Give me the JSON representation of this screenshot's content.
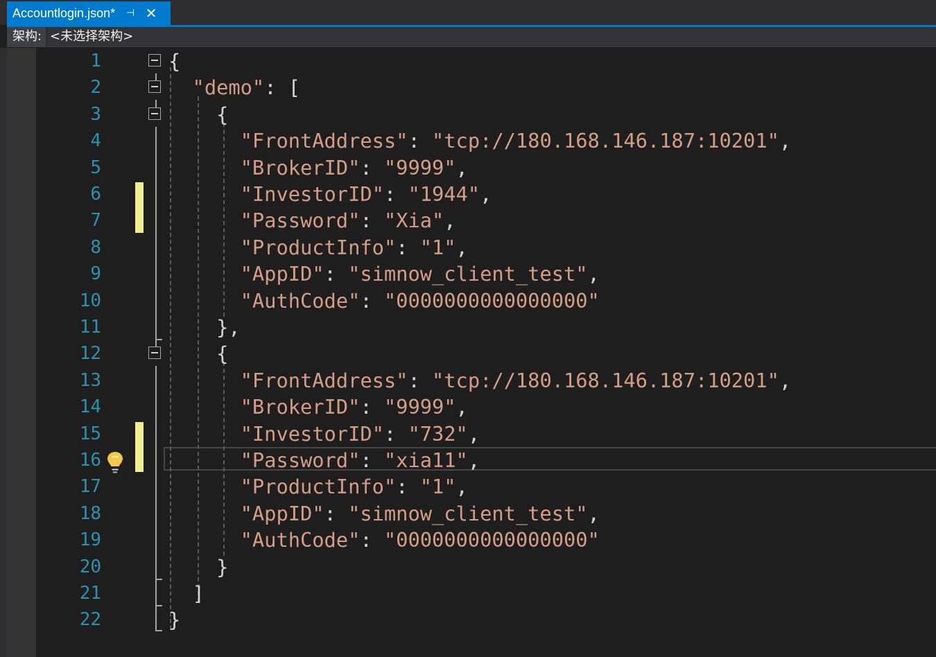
{
  "tab": {
    "title": "Accountlogin.json*",
    "pin_glyph": "⊣",
    "close_glyph": "✕"
  },
  "navbar": {
    "label": "架构:",
    "dropdown_value": "<未选择架构>"
  },
  "editor": {
    "line_numbers": [
      "1",
      "2",
      "3",
      "4",
      "5",
      "6",
      "7",
      "8",
      "9",
      "10",
      "11",
      "12",
      "13",
      "14",
      "15",
      "16",
      "17",
      "18",
      "19",
      "20",
      "21",
      "22"
    ],
    "lines": [
      [
        {
          "c": "p",
          "t": "{"
        }
      ],
      [
        {
          "c": "p",
          "t": "  "
        },
        {
          "c": "k",
          "t": "\"demo\""
        },
        {
          "c": "p",
          "t": ": ["
        }
      ],
      [
        {
          "c": "p",
          "t": "    {"
        }
      ],
      [
        {
          "c": "p",
          "t": "      "
        },
        {
          "c": "k",
          "t": "\"FrontAddress\""
        },
        {
          "c": "p",
          "t": ": "
        },
        {
          "c": "k",
          "t": "\"tcp://180.168.146.187:10201\""
        },
        {
          "c": "p",
          "t": ","
        }
      ],
      [
        {
          "c": "p",
          "t": "      "
        },
        {
          "c": "k",
          "t": "\"BrokerID\""
        },
        {
          "c": "p",
          "t": ": "
        },
        {
          "c": "k",
          "t": "\"9999\""
        },
        {
          "c": "p",
          "t": ","
        }
      ],
      [
        {
          "c": "p",
          "t": "      "
        },
        {
          "c": "k",
          "t": "\"InvestorID\""
        },
        {
          "c": "p",
          "t": ": "
        },
        {
          "c": "k",
          "t": "\"1944\""
        },
        {
          "c": "p",
          "t": ","
        }
      ],
      [
        {
          "c": "p",
          "t": "      "
        },
        {
          "c": "k",
          "t": "\"Password\""
        },
        {
          "c": "p",
          "t": ": "
        },
        {
          "c": "k",
          "t": "\"Xia\""
        },
        {
          "c": "p",
          "t": ","
        }
      ],
      [
        {
          "c": "p",
          "t": "      "
        },
        {
          "c": "k",
          "t": "\"ProductInfo\""
        },
        {
          "c": "p",
          "t": ": "
        },
        {
          "c": "k",
          "t": "\"1\""
        },
        {
          "c": "p",
          "t": ","
        }
      ],
      [
        {
          "c": "p",
          "t": "      "
        },
        {
          "c": "k",
          "t": "\"AppID\""
        },
        {
          "c": "p",
          "t": ": "
        },
        {
          "c": "k",
          "t": "\"simnow_client_test\""
        },
        {
          "c": "p",
          "t": ","
        }
      ],
      [
        {
          "c": "p",
          "t": "      "
        },
        {
          "c": "k",
          "t": "\"AuthCode\""
        },
        {
          "c": "p",
          "t": ": "
        },
        {
          "c": "k",
          "t": "\"0000000000000000\""
        }
      ],
      [
        {
          "c": "p",
          "t": "    },"
        }
      ],
      [
        {
          "c": "p",
          "t": "    {"
        }
      ],
      [
        {
          "c": "p",
          "t": "      "
        },
        {
          "c": "k",
          "t": "\"FrontAddress\""
        },
        {
          "c": "p",
          "t": ": "
        },
        {
          "c": "k",
          "t": "\"tcp://180.168.146.187:10201\""
        },
        {
          "c": "p",
          "t": ","
        }
      ],
      [
        {
          "c": "p",
          "t": "      "
        },
        {
          "c": "k",
          "t": "\"BrokerID\""
        },
        {
          "c": "p",
          "t": ": "
        },
        {
          "c": "k",
          "t": "\"9999\""
        },
        {
          "c": "p",
          "t": ","
        }
      ],
      [
        {
          "c": "p",
          "t": "      "
        },
        {
          "c": "k",
          "t": "\"InvestorID\""
        },
        {
          "c": "p",
          "t": ": "
        },
        {
          "c": "k",
          "t": "\"732\""
        },
        {
          "c": "p",
          "t": ","
        }
      ],
      [
        {
          "c": "p",
          "t": "      "
        },
        {
          "c": "k",
          "t": "\"Password\""
        },
        {
          "c": "p",
          "t": ": "
        },
        {
          "c": "k",
          "t": "\"xia11\""
        },
        {
          "c": "p",
          "t": ","
        }
      ],
      [
        {
          "c": "p",
          "t": "      "
        },
        {
          "c": "k",
          "t": "\"ProductInfo\""
        },
        {
          "c": "p",
          "t": ": "
        },
        {
          "c": "k",
          "t": "\"1\""
        },
        {
          "c": "p",
          "t": ","
        }
      ],
      [
        {
          "c": "p",
          "t": "      "
        },
        {
          "c": "k",
          "t": "\"AppID\""
        },
        {
          "c": "p",
          "t": ": "
        },
        {
          "c": "k",
          "t": "\"simnow_client_test\""
        },
        {
          "c": "p",
          "t": ","
        }
      ],
      [
        {
          "c": "p",
          "t": "      "
        },
        {
          "c": "k",
          "t": "\"AuthCode\""
        },
        {
          "c": "p",
          "t": ": "
        },
        {
          "c": "k",
          "t": "\"0000000000000000\""
        }
      ],
      [
        {
          "c": "p",
          "t": "    }"
        }
      ],
      [
        {
          "c": "p",
          "t": "  ]"
        }
      ],
      [
        {
          "c": "p",
          "t": "}"
        }
      ]
    ],
    "changed_lines": [
      6,
      7,
      15,
      16
    ],
    "current_line": 16,
    "lightbulb_line": 16,
    "fold_lines": [
      1,
      2,
      3,
      12
    ],
    "colors": {
      "string": "#d69d85",
      "punctuation": "#d4d4d4",
      "line_number": "#2b91af",
      "change_marker": "#efef91",
      "accent": "#007acc"
    },
    "icons": [
      "pin-icon",
      "close-icon",
      "collapse-icon",
      "lightbulb-icon"
    ]
  }
}
